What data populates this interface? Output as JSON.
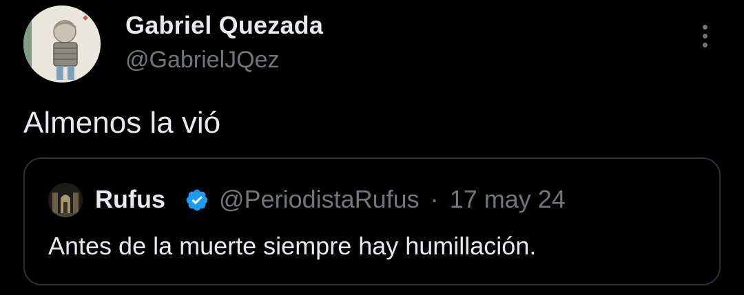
{
  "tweet": {
    "author": {
      "name": "Gabriel Quezada",
      "handle": "@GabrielJQez"
    },
    "text": "Almenos la vió",
    "more_icon": "more-vertical-icon"
  },
  "quoted_tweet": {
    "author": {
      "name": "Rufus",
      "handle": "@PeriodistaRufus",
      "verified": true
    },
    "separator": "·",
    "date": "17 may 24",
    "text": "Antes de la muerte siempre hay humillación."
  },
  "colors": {
    "background": "#000000",
    "primary_text": "#e7e9ea",
    "secondary_text": "#71767b",
    "border": "#2f3336",
    "verified_badge": "#1d9bf0"
  }
}
